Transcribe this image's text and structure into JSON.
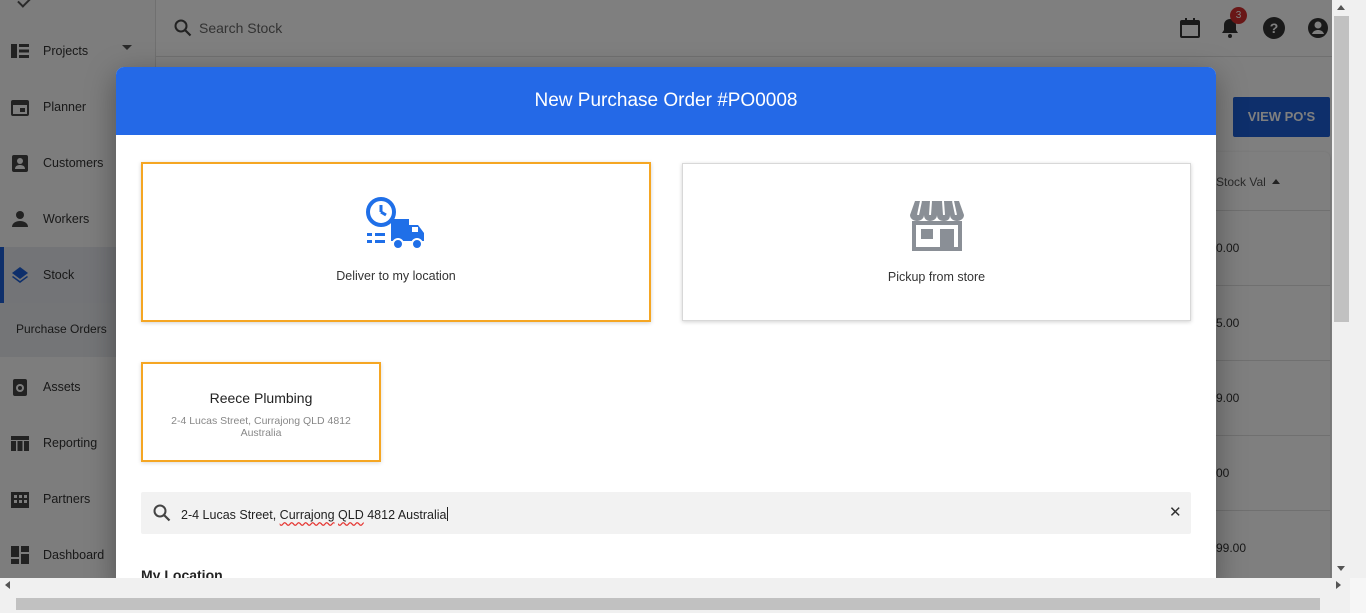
{
  "topbar": {
    "search_placeholder": "Search Stock",
    "notification_count": "3"
  },
  "sidebar": {
    "items": [
      {
        "label": "Projects",
        "icon": "projects-icon"
      },
      {
        "label": "Planner",
        "icon": "calendar-icon"
      },
      {
        "label": "Customers",
        "icon": "contact-icon"
      },
      {
        "label": "Workers",
        "icon": "person-icon"
      },
      {
        "label": "Stock",
        "icon": "layers-icon"
      },
      {
        "label": "Assets",
        "icon": "assets-icon"
      },
      {
        "label": "Reporting",
        "icon": "table-icon"
      },
      {
        "label": "Partners",
        "icon": "building-icon"
      },
      {
        "label": "Dashboard",
        "icon": "dashboard-icon"
      }
    ],
    "sub_item": "Purchase Orders"
  },
  "page": {
    "view_pos_label": "VIEW PO'S",
    "stock_val_header": "Stock Val",
    "stock_values": [
      "0.00",
      "5.00",
      "9.00",
      "00",
      "99.00"
    ]
  },
  "modal": {
    "title": "New Purchase Order #PO0008",
    "option_deliver": "Deliver to my location",
    "option_pickup": "Pickup from store",
    "store": {
      "name": "Reece Plumbing",
      "address": "2-4 Lucas Street, Currajong QLD 4812 Australia"
    },
    "address_input": {
      "part1": "2-4 Lucas Street, ",
      "part2": "Currajong",
      "part3": " ",
      "part4": "QLD",
      "part5": " 4812 Australia"
    },
    "section_heading": "My Location"
  },
  "colors": {
    "primary": "#2469e7",
    "selected_border": "#f5a623",
    "badge": "#d32f2f"
  }
}
